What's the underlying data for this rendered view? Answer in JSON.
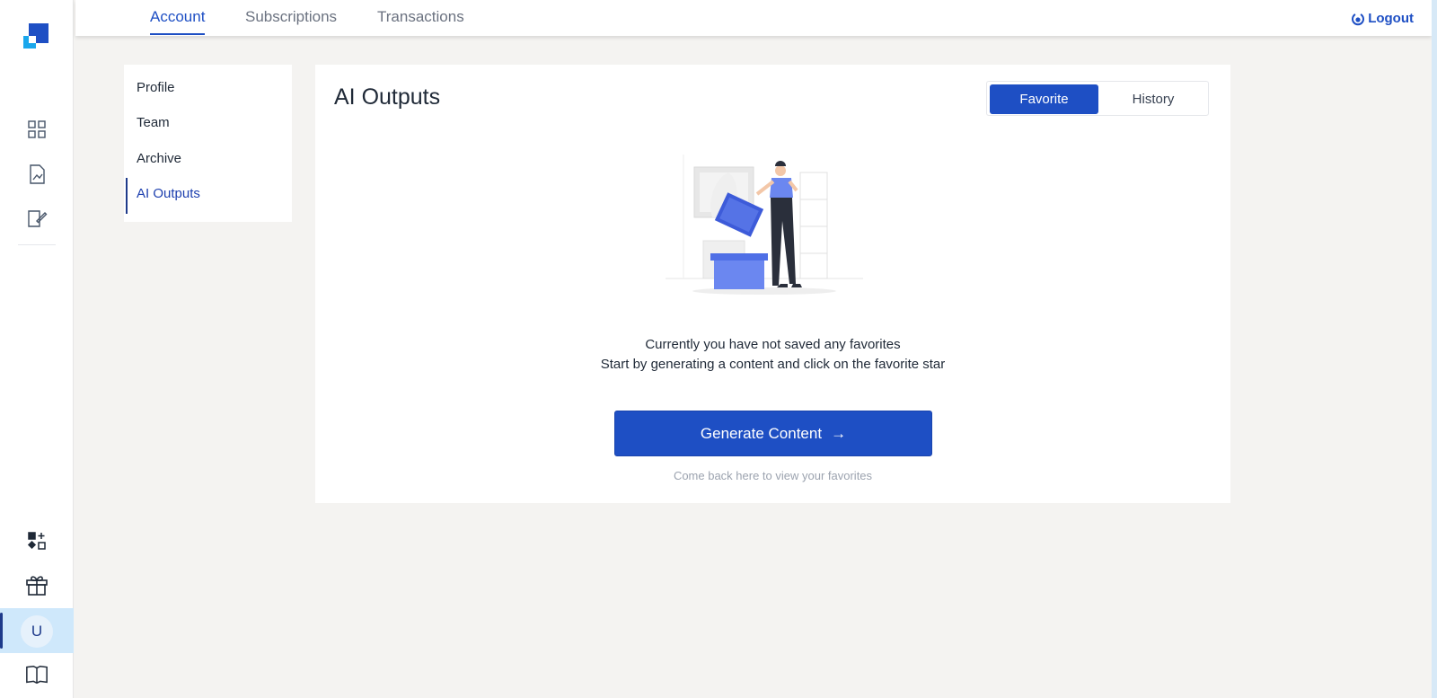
{
  "nav": {
    "tabs": [
      {
        "label": "Account",
        "active": true
      },
      {
        "label": "Subscriptions",
        "active": false
      },
      {
        "label": "Transactions",
        "active": false
      }
    ],
    "logout_label": "Logout"
  },
  "rail": {
    "icons": [
      "dashboard-grid-icon",
      "report-chart-icon",
      "edit-note-icon",
      "add-widget-icon",
      "gift-icon",
      "guide-book-icon"
    ],
    "avatar_initial": "U"
  },
  "submenu": {
    "items": [
      {
        "label": "Profile",
        "active": false
      },
      {
        "label": "Team",
        "active": false
      },
      {
        "label": "Archive",
        "active": false
      },
      {
        "label": "AI Outputs",
        "active": true
      }
    ]
  },
  "main": {
    "title": "AI Outputs",
    "toggle": {
      "favorite": "Favorite",
      "history": "History",
      "selected": "Favorite"
    },
    "empty_line1": "Currently you have not saved any favorites",
    "empty_line2": "Start by generating a content and click on the favorite star",
    "cta_label": "Generate Content",
    "cta_arrow": "→",
    "hint": "Come back here to view your favorites"
  },
  "colors": {
    "accent": "#1e4fc4",
    "background": "#f4f3f1",
    "rail_highlight": "#cfe8fb"
  }
}
